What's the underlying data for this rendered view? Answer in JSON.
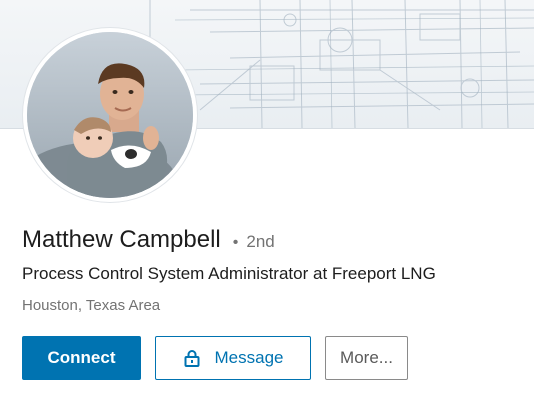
{
  "profile": {
    "name": "Matthew Campbell",
    "degree_separator": "•",
    "degree": "2nd",
    "headline": "Process Control System Administrator at Freeport LNG",
    "location": "Houston, Texas Area"
  },
  "actions": {
    "connect_label": "Connect",
    "message_label": "Message",
    "more_label": "More..."
  },
  "icons": {
    "message": "lock-icon",
    "avatar": "profile-photo",
    "banner": "blueprint-background"
  },
  "colors": {
    "primary": "#0073b1",
    "text": "#1d1d1d",
    "muted": "#737373"
  }
}
